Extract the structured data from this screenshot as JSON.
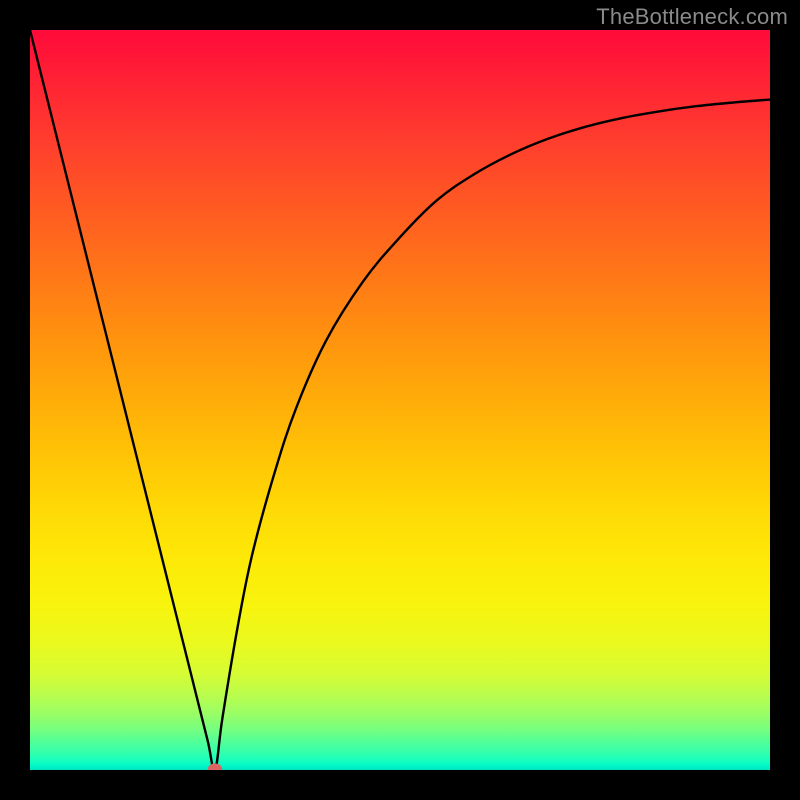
{
  "watermark": "TheBottleneck.com",
  "chart_data": {
    "type": "line",
    "title": "",
    "xlabel": "",
    "ylabel": "",
    "xlim": [
      0,
      100
    ],
    "ylim": [
      0,
      100
    ],
    "grid": false,
    "legend": false,
    "background": "red-yellow-green vertical gradient",
    "series": [
      {
        "name": "bottleneck-curve",
        "color": "#000000",
        "x": [
          0,
          2,
          4,
          6,
          8,
          10,
          12,
          14,
          16,
          18,
          20,
          22,
          24,
          25,
          26,
          28,
          30,
          33,
          36,
          40,
          45,
          50,
          55,
          60,
          65,
          70,
          75,
          80,
          85,
          90,
          95,
          100
        ],
        "y": [
          100,
          92,
          84,
          76,
          68,
          60,
          52,
          44,
          36,
          28,
          20,
          12,
          4,
          0,
          7,
          19,
          29,
          40,
          49,
          58,
          66,
          72,
          77,
          80.5,
          83.2,
          85.3,
          86.9,
          88.1,
          89.0,
          89.7,
          90.2,
          90.6
        ]
      }
    ],
    "marker": {
      "name": "minimum-point",
      "x": 25,
      "y": 0,
      "color": "#db6565"
    }
  }
}
